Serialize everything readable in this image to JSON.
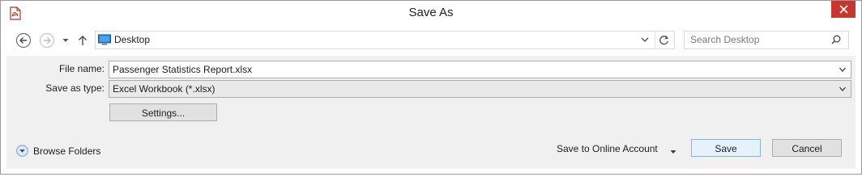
{
  "window": {
    "title": "Save As",
    "accent_close": "#c7372f"
  },
  "titlebar": {
    "app_icon": "pdf-document-icon",
    "close_icon": "close-icon"
  },
  "navigation": {
    "back_icon": "back-arrow-icon",
    "forward_icon": "forward-arrow-icon",
    "recent_icon": "chevron-down-icon",
    "up_icon": "up-arrow-icon",
    "address": {
      "location_icon": "desktop-icon",
      "path": "Desktop"
    },
    "refresh_icon": "refresh-icon",
    "search": {
      "placeholder": "Search Desktop",
      "icon": "search-icon"
    }
  },
  "form": {
    "file_name_label": "File name:",
    "file_name_value": "Passenger Statistics Report.xlsx",
    "save_type_label": "Save as type:",
    "save_type_value": "Excel Workbook (*.xlsx)",
    "settings_label": "Settings..."
  },
  "footer": {
    "browse_folders_label": "Browse Folders",
    "save_online_label": "Save to Online Account",
    "save_label": "Save",
    "cancel_label": "Cancel"
  }
}
